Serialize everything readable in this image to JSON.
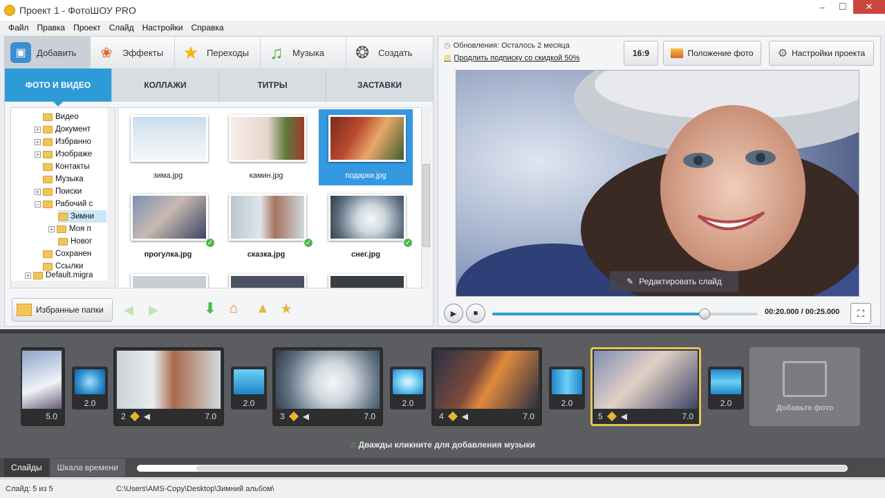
{
  "window": {
    "title": "Проект 1 - ФотоШОУ PRO"
  },
  "menu": [
    "Файл",
    "Правка",
    "Проект",
    "Слайд",
    "Настройки",
    "Справка"
  ],
  "main_tabs": [
    {
      "label": "Добавить",
      "icon": "photo-add-icon"
    },
    {
      "label": "Эффекты",
      "icon": "palette-icon"
    },
    {
      "label": "Переходы",
      "icon": "star-icon"
    },
    {
      "label": "Музыка",
      "icon": "music-note-icon"
    },
    {
      "label": "Создать",
      "icon": "film-reel-icon"
    }
  ],
  "sub_tabs": [
    "ФОТО И ВИДЕО",
    "КОЛЛАЖИ",
    "ТИТРЫ",
    "ЗАСТАВКИ"
  ],
  "tree": [
    {
      "label": "Видео"
    },
    {
      "label": "Документ"
    },
    {
      "label": "Избранно"
    },
    {
      "label": "Изображе"
    },
    {
      "label": "Контакты"
    },
    {
      "label": "Музыка"
    },
    {
      "label": "Поиски"
    },
    {
      "label": "Рабочий с"
    },
    {
      "label": "Зимни"
    },
    {
      "label": "Моя п"
    },
    {
      "label": "Новог"
    },
    {
      "label": "Сохранен"
    },
    {
      "label": "Ссылки"
    },
    {
      "label": "Default.migra"
    }
  ],
  "thumbnails": [
    {
      "name": "зима.jpg"
    },
    {
      "name": "камин.jpg"
    },
    {
      "name": "подарки.jpg"
    },
    {
      "name": "прогулка.jpg"
    },
    {
      "name": "сказка.jpg"
    },
    {
      "name": "снег.jpg"
    }
  ],
  "left_toolbar": {
    "favorites_label": "Избранные папки"
  },
  "updates": {
    "line1": "Обновления: Осталось 2 месяца",
    "line2": "Продлить подписку со скидкой 50%"
  },
  "right_toolbar": {
    "ratio": "16:9",
    "photo_position": "Положение фото",
    "project_settings": "Настройки проекта"
  },
  "preview": {
    "edit_slide": "Редактировать слайд"
  },
  "player": {
    "timecode": "00:20.000 / 00:25.000",
    "progress": 0.8
  },
  "filmstrip": {
    "first_partial_duration": "5.0",
    "slides": [
      {
        "number": "2",
        "duration": "7.0"
      },
      {
        "number": "3",
        "duration": "7.0"
      },
      {
        "number": "4",
        "duration": "7.0"
      },
      {
        "number": "5",
        "duration": "7.0"
      }
    ],
    "transitions": [
      "2.0",
      "2.0",
      "2.0",
      "2.0",
      "2.0"
    ],
    "add_photo": "Добавьте фото",
    "music_hint": "Дважды кликните для добавления музыки"
  },
  "bottom_tabs": [
    "Слайды",
    "Шкала времени"
  ],
  "status": {
    "slide_counter": "Слайд: 5 из 5",
    "path": "C:\\Users\\AMS-Copy\\Desktop\\Зимний альбом\\"
  }
}
